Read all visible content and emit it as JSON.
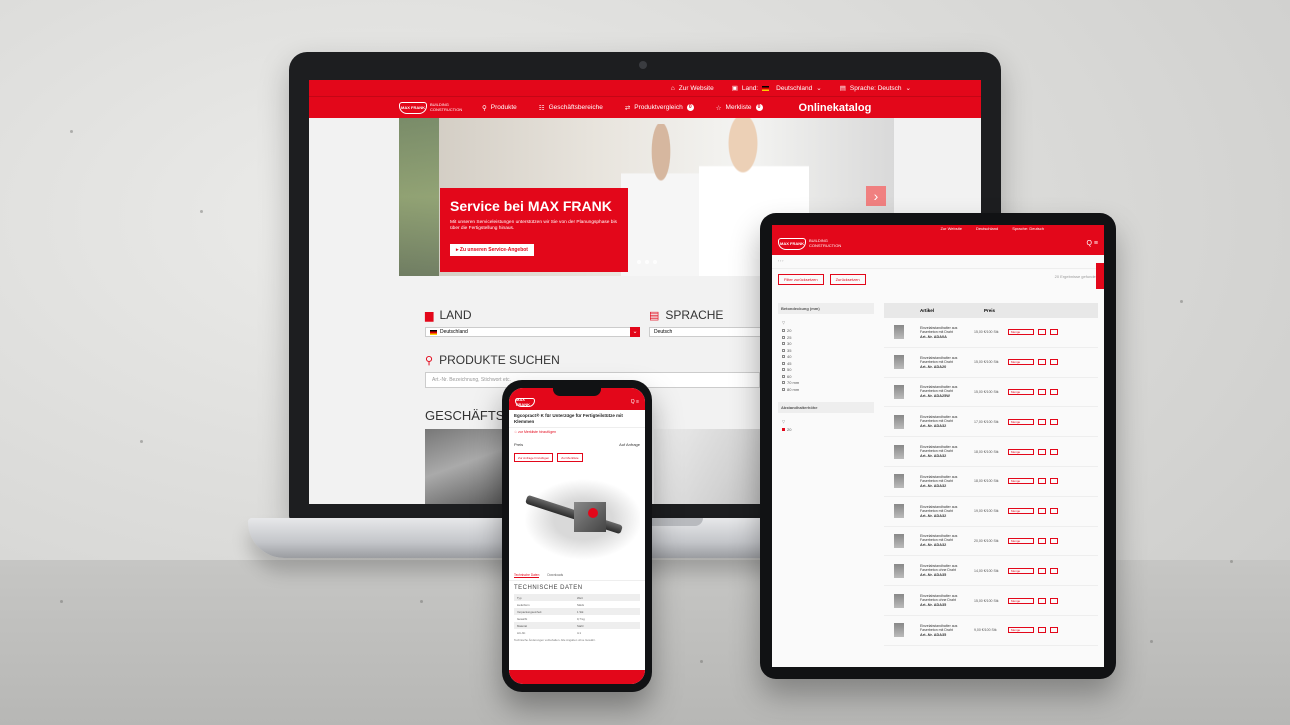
{
  "laptop": {
    "topbar": {
      "website": "Zur Website",
      "land": "Land:",
      "land_value": "Deutschland",
      "sprache": "Sprache: Deutsch"
    },
    "nav": {
      "logo": "MAX FRANK",
      "claim": "BUILDING CONSTRUCTION",
      "items": [
        "Produkte",
        "Geschäftsbereiche",
        "Produktvergleich",
        "Merkliste"
      ],
      "catalog": "Onlinekatalog"
    },
    "hero": {
      "title": "Service bei MAX FRANK",
      "text": "Mit unseren Serviceleistungen unterstützen wir Sie von der Planungsphase bis über die Fertigstellung hinaus.",
      "cta": "Zu unseren Service-Angebot"
    },
    "land_section": {
      "title": "LAND",
      "value": "Deutschland"
    },
    "sprache_section": {
      "title": "SPRACHE",
      "value": "Deutsch"
    },
    "search_section": {
      "title": "PRODUKTE SUCHEN",
      "placeholder": "Art.-Nr. Bezeichnung, Stichwort etc."
    },
    "bereiche_title": "GESCHÄFTSBE"
  },
  "tablet": {
    "nav_right": "Q ≡",
    "filters": {
      "reset": "Filter zurücksetzen",
      "back": "Zurücksetzen",
      "results": "20 Ergebnisse gefunden"
    },
    "sidebar": {
      "group1": "Betondeckung (mm)",
      "options": [
        "20",
        "25",
        "30",
        "35",
        "40",
        "45",
        "50",
        "60",
        "70 mm",
        "80 mm"
      ],
      "group2": "Abstandhalterhöhe"
    },
    "table_header": {
      "artikel": "Artikel",
      "preis": "Preis"
    },
    "rows": [
      {
        "desc": "Einzelabstandhalter aus Faserbeton mit Draht",
        "art": "Art.-Nr. ADA0A",
        "price": "15,00 €/100 Stk",
        "sel": "Menge"
      },
      {
        "desc": "Einzelabstandhalter aus Faserbeton mit Draht",
        "art": "Art.-Nr. ADA20",
        "price": "15,00 €/100 Stk",
        "sel": "Menge"
      },
      {
        "desc": "Einzelabstandhalter aus Faserbeton mit Draht",
        "art": "Art.-Nr. ADA25W",
        "price": "15,00 €/100 Stk",
        "sel": "Menge"
      },
      {
        "desc": "Einzelabstandhalter aus Faserbeton mit Draht",
        "art": "Art.-Nr. ADA32",
        "price": "17,00 €/100 Stk",
        "sel": "Menge"
      },
      {
        "desc": "Einzelabstandhalter aus Faserbeton mit Draht",
        "art": "Art.-Nr. ADA32",
        "price": "18,00 €/100 Stk",
        "sel": "Menge"
      },
      {
        "desc": "Einzelabstandhalter aus Faserbeton mit Draht",
        "art": "Art.-Nr. ADA32",
        "price": "18,00 €/100 Stk",
        "sel": "Menge"
      },
      {
        "desc": "Einzelabstandhalter aus Faserbeton mit Draht",
        "art": "Art.-Nr. ADA32",
        "price": "19,00 €/100 Stk",
        "sel": "Menge"
      },
      {
        "desc": "Einzelabstandhalter aus Faserbeton mit Draht",
        "art": "Art.-Nr. ADA32",
        "price": "20,00 €/100 Stk",
        "sel": "Menge"
      },
      {
        "desc": "Einzelabstandhalter aus Faserbeton ohne Draht",
        "art": "Art.-Nr. ADA35",
        "price": "14,00 €/100 Stk",
        "sel": "Menge"
      },
      {
        "desc": "Einzelabstandhalter aus Faserbeton ohne Draht",
        "art": "Art.-Nr. ADA35",
        "price": "15,00 €/100 Stk",
        "sel": "Menge"
      },
      {
        "desc": "Einzelabstandhalter aus Faserbeton mit Draht",
        "art": "Art.-Nr. ADA35",
        "price": "9,00 €/100 Stk",
        "sel": "Menge"
      }
    ]
  },
  "phone": {
    "nav_right": "Q ≡",
    "title": "Egcopract® K für Unterzüge für Fertigteilstütze mit Klemmen",
    "link": "zur Merkliste hinzufügen",
    "price_label": "Preis",
    "price_value": "Auf Anfrage",
    "btn1": "Zur Anfrage hinzufügen",
    "btn2": "Zur Merkliste",
    "tabs": [
      "Technische Daten",
      "Downloads"
    ],
    "tech_title": "TECHNISCHE DATEN",
    "tech_rows": [
      [
        "Typ",
        "Wert"
      ],
      [
        "Lieferform",
        "Stück"
      ],
      [
        "Verpackungseinheit",
        "1 Stk"
      ],
      [
        "Gewicht",
        "0,7 kg"
      ],
      [
        "Material",
        "Stahl"
      ],
      [
        "Art.-Nr.",
        "4.1"
      ]
    ],
    "text": "Technische Änderungen vorbehalten. Alle Angaben ohne Gewähr."
  }
}
